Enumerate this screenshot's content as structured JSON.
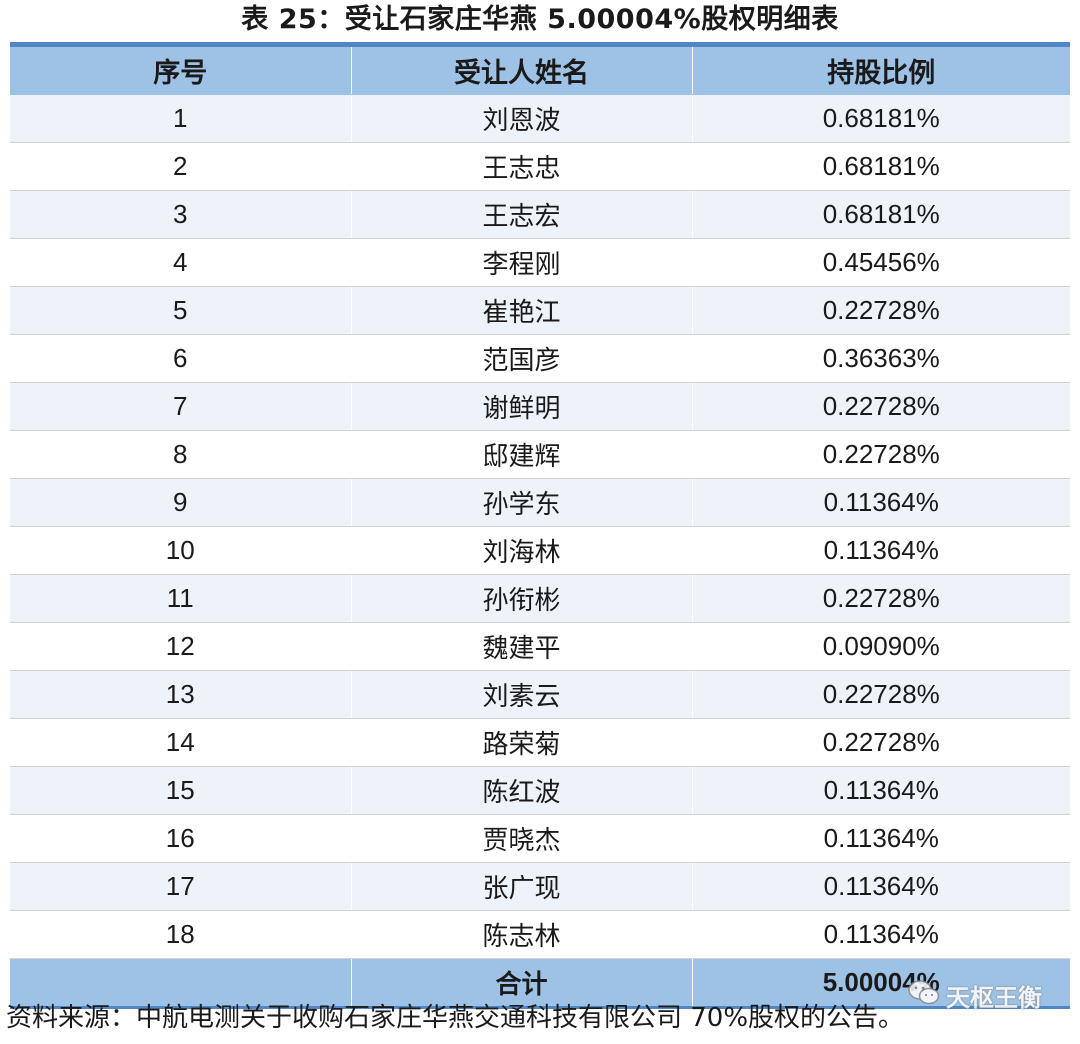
{
  "title": "表  25：受让石家庄华燕 5.00004%股权明细表",
  "table": {
    "headers": [
      "序号",
      "受让人姓名",
      "持股比例"
    ],
    "rows": [
      {
        "no": "1",
        "name": "刘恩波",
        "pct": "0.68181%"
      },
      {
        "no": "2",
        "name": "王志忠",
        "pct": "0.68181%"
      },
      {
        "no": "3",
        "name": "王志宏",
        "pct": "0.68181%"
      },
      {
        "no": "4",
        "name": "李程刚",
        "pct": "0.45456%"
      },
      {
        "no": "5",
        "name": "崔艳江",
        "pct": "0.22728%"
      },
      {
        "no": "6",
        "name": "范国彦",
        "pct": "0.36363%"
      },
      {
        "no": "7",
        "name": "谢鲜明",
        "pct": "0.22728%"
      },
      {
        "no": "8",
        "name": "邸建辉",
        "pct": "0.22728%"
      },
      {
        "no": "9",
        "name": "孙学东",
        "pct": "0.11364%"
      },
      {
        "no": "10",
        "name": "刘海林",
        "pct": "0.11364%"
      },
      {
        "no": "11",
        "name": "孙衔彬",
        "pct": "0.22728%"
      },
      {
        "no": "12",
        "name": "魏建平",
        "pct": "0.09090%"
      },
      {
        "no": "13",
        "name": "刘素云",
        "pct": "0.22728%"
      },
      {
        "no": "14",
        "name": "路荣菊",
        "pct": "0.22728%"
      },
      {
        "no": "15",
        "name": "陈红波",
        "pct": "0.11364%"
      },
      {
        "no": "16",
        "name": "贾晓杰",
        "pct": "0.11364%"
      },
      {
        "no": "17",
        "name": "张广现",
        "pct": "0.11364%"
      },
      {
        "no": "18",
        "name": "陈志林",
        "pct": "0.11364%"
      }
    ],
    "total": {
      "no": "",
      "name": "合计",
      "pct": "5.00004%"
    }
  },
  "source": "资料来源：中航电测关于收购石家庄华燕交通科技有限公司 70%股权的公告。",
  "watermark": {
    "text": "天枢王衡",
    "icon": "wechat-icon"
  },
  "colors": {
    "header_fill": "#9ec2e5",
    "rule": "#4f86c6",
    "zebra": "#eef3fa"
  }
}
